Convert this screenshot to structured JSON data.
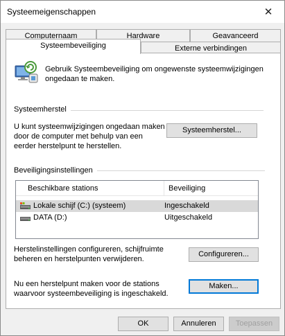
{
  "window": {
    "title": "Systeemeigenschappen",
    "close_symbol": "✕"
  },
  "tabs": {
    "row1": [
      "Computernaam",
      "Hardware",
      "Geavanceerd"
    ],
    "row2": [
      "Systeembeveiliging",
      "Externe verbindingen"
    ],
    "active": "Systeembeveiliging"
  },
  "intro": {
    "icon": "system-protection-icon",
    "line1": "Gebruik Systeembeveiliging om ongewenste systeemwijzigingen",
    "line2": "ongedaan te maken."
  },
  "restore": {
    "section_title": "Systeemherstel",
    "line1": "U kunt systeemwijzigingen ongedaan maken",
    "line2": "door de computer met behulp van een",
    "line3": "eerder herstelpunt te herstellen.",
    "button_label": "Systeemherstel..."
  },
  "protection": {
    "section_title": "Beveiligingsinstellingen",
    "columns": [
      "Beschikbare stations",
      "Beveiliging"
    ],
    "rows": [
      {
        "name": "Lokale schijf (C:) (systeem)",
        "status": "Ingeschakeld",
        "icon": "system-drive-icon",
        "selected": true
      },
      {
        "name": "DATA (D:)",
        "status": "Uitgeschakeld",
        "icon": "drive-icon",
        "selected": false
      }
    ],
    "configure_line1": "Herstelinstellingen configureren, schijfruimte",
    "configure_line2": "beheren en herstelpunten verwijderen.",
    "configure_button": "Configureren...",
    "create_line1": "Nu een herstelpunt maken voor de stations",
    "create_line2": "waarvoor systeembeveiliging is ingeschakeld.",
    "create_button": "Maken..."
  },
  "footer": {
    "ok": "OK",
    "cancel": "Annuleren",
    "apply": "Toepassen"
  },
  "colors": {
    "focus_blue": "#0078d7",
    "selected_row": "#d9d9d9",
    "panel_bg": "#ffffff",
    "window_bg": "#f0f0f0"
  }
}
